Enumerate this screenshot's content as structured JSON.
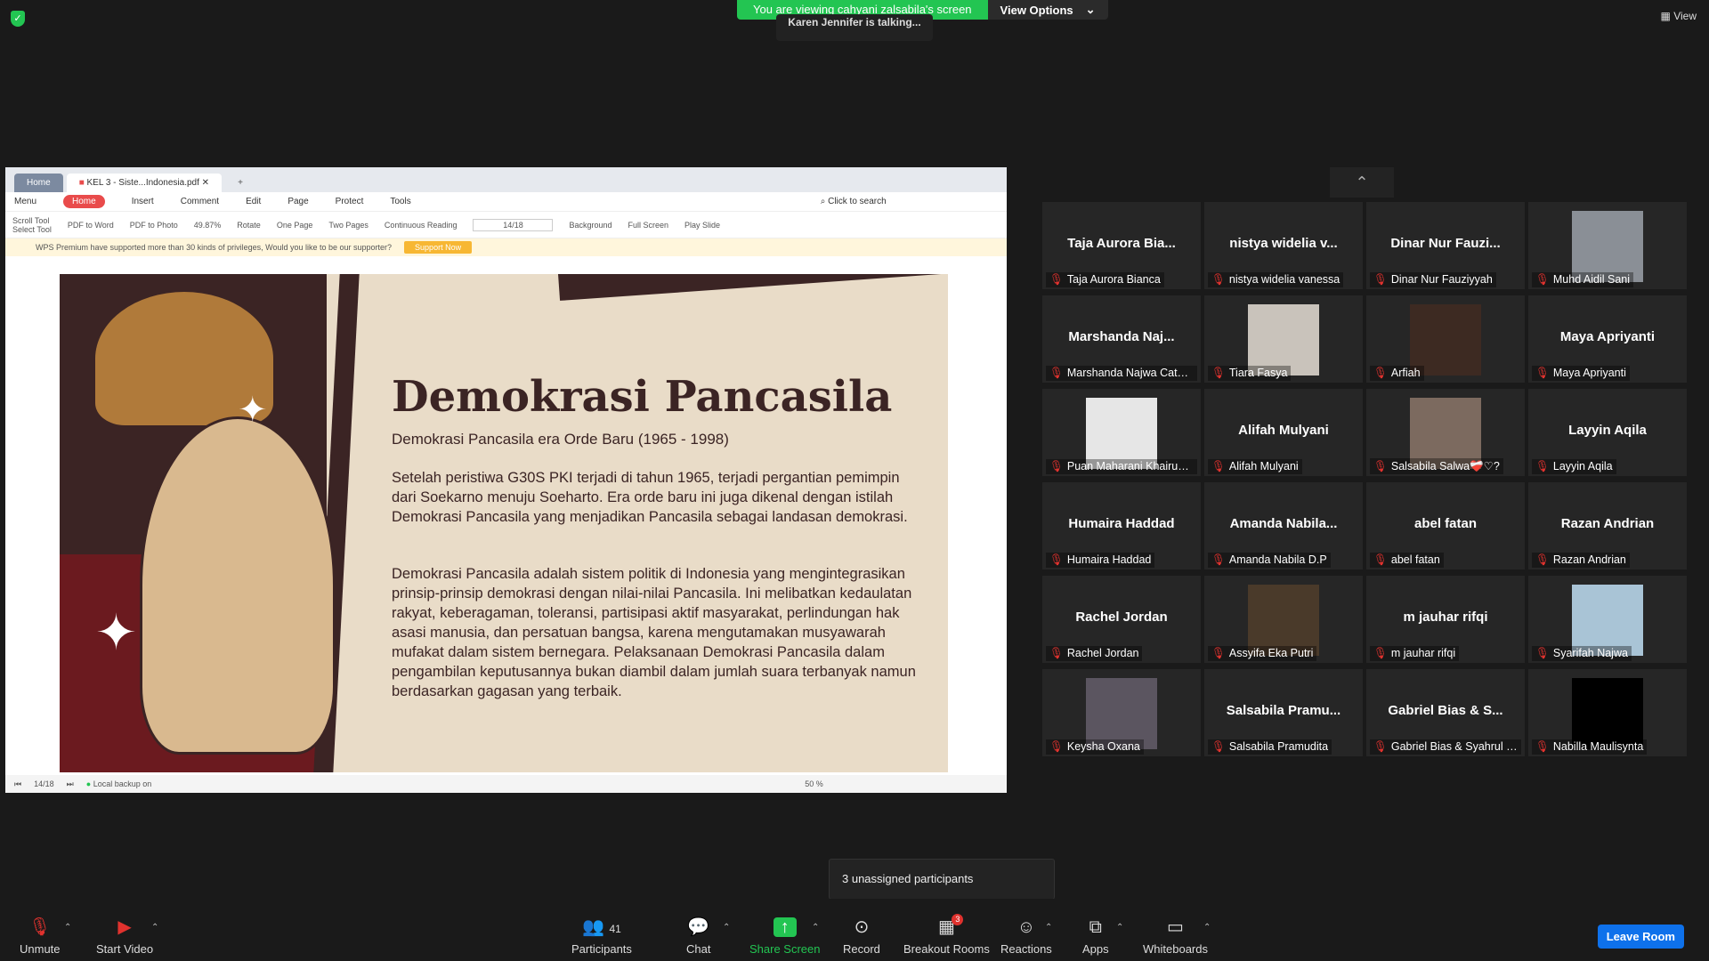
{
  "banner": {
    "viewing": "You are viewing cahyani zalsabila's screen",
    "view_options": "View Options"
  },
  "talking": "Karen Jennifer is talking...",
  "view_button": "View",
  "wps": {
    "tabs": [
      "Home",
      "KEL 3 - Siste...Indonesia.pdf"
    ],
    "menu": [
      "Menu",
      "Home",
      "Insert",
      "Comment",
      "Edit",
      "Page",
      "Protect",
      "Tools"
    ],
    "search": "Click to search",
    "toolbar": [
      "Scroll Tool",
      "Select Tool",
      "PDF to Word",
      "PDF to Photo",
      "49.87%",
      "Rotate",
      "One Page",
      "Two Pages",
      "Continuous Reading",
      "Background",
      "Full Screen",
      "Play Slide"
    ],
    "page_field": "14/18",
    "notice": "WPS Premium have supported more than 30 kinds of privileges, Would you like to be our supporter?",
    "support_button": "Support Now",
    "status_backup": "Local backup on",
    "zoom": "50 %"
  },
  "slide": {
    "title": "Demokrasi Pancasila",
    "subtitle": "Demokrasi Pancasila era Orde Baru (1965 - 1998)",
    "para1": "Setelah peristiwa G30S PKI terjadi di tahun 1965, terjadi pergantian pemimpin dari Soekarno menuju Soeharto. Era orde baru ini juga dikenal dengan istilah Demokrasi Pancasila yang menjadikan Pancasila sebagai landasan demokrasi.",
    "para2": "Demokrasi Pancasila adalah sistem politik di Indonesia yang mengintegrasikan prinsip-prinsip demokrasi dengan nilai-nilai Pancasila. Ini melibatkan kedaulatan rakyat, keberagaman, toleransi, partisipasi aktif masyarakat, perlindungan hak asasi manusia, dan persatuan bangsa, karena mengutamakan musyawarah mufakat dalam sistem bernegara. Pelaksanaan Demokrasi Pancasila dalam pengambilan keputusannya bukan diambil dalam jumlah suara terbanyak namun berdasarkan gagasan yang terbaik."
  },
  "participants": [
    {
      "big": "Taja Aurora Bia...",
      "name": "Taja Aurora Bianca",
      "photo": false
    },
    {
      "big": "nistya widelia v...",
      "name": "nistya widelia vanessa",
      "photo": false
    },
    {
      "big": "Dinar Nur Fauzi...",
      "name": "Dinar Nur Fauziyyah",
      "photo": false
    },
    {
      "big": "",
      "name": "Muhd Aidil Sani",
      "photo": true,
      "color": "#8a8f96"
    },
    {
      "big": "Marshanda Naj...",
      "name": "Marshanda Najwa Catel...",
      "photo": false
    },
    {
      "big": "",
      "name": "Tiara Fasya",
      "photo": true,
      "color": "#c9c3bb"
    },
    {
      "big": "",
      "name": "Arfiah",
      "photo": true,
      "color": "#3d2a22"
    },
    {
      "big": "Maya Apriyanti",
      "name": "Maya Apriyanti",
      "photo": false
    },
    {
      "big": "",
      "name": "Puan Maharani Khairunn...",
      "photo": true,
      "color": "#e6e6e6"
    },
    {
      "big": "Alifah Mulyani",
      "name": "Alifah Mulyani",
      "photo": false
    },
    {
      "big": "",
      "name": "Salsabila Salwa❤️‍🩹♡?",
      "photo": true,
      "color": "#7c6a5f"
    },
    {
      "big": "Layyin Aqila",
      "name": "Layyin Aqila",
      "photo": false
    },
    {
      "big": "Humaira Haddad",
      "name": "Humaira Haddad",
      "photo": false
    },
    {
      "big": "Amanda Nabila...",
      "name": "Amanda Nabila D.P",
      "photo": false
    },
    {
      "big": "abel fatan",
      "name": "abel fatan",
      "photo": false
    },
    {
      "big": "Razan Andrian",
      "name": "Razan Andrian",
      "photo": false
    },
    {
      "big": "Rachel Jordan",
      "name": "Rachel Jordan",
      "photo": false
    },
    {
      "big": "",
      "name": "Assyifa Eka Putri",
      "photo": true,
      "color": "#4a3a2a"
    },
    {
      "big": "m jauhar rifqi",
      "name": "m jauhar rifqi",
      "photo": false
    },
    {
      "big": "",
      "name": "Syarifah Najwa",
      "photo": true,
      "color": "#a9c4d6"
    },
    {
      "big": "",
      "name": "Keysha Oxana",
      "photo": true,
      "color": "#5b5560"
    },
    {
      "big": "Salsabila Pramu...",
      "name": "Salsabila Pramudita",
      "photo": false
    },
    {
      "big": "Gabriel Bias & S...",
      "name": "Gabriel Bias & Syahrul G...",
      "photo": false
    },
    {
      "big": "",
      "name": "Nabilla Maulisynta",
      "photo": true,
      "color": "#000000"
    }
  ],
  "toast": "3 unassigned participants",
  "controls": {
    "unmute": "Unmute",
    "start_video": "Start Video",
    "participants": "Participants",
    "participants_count": "41",
    "chat": "Chat",
    "share_screen": "Share Screen",
    "record": "Record",
    "breakout": "Breakout Rooms",
    "breakout_badge": "3",
    "reactions": "Reactions",
    "apps": "Apps",
    "whiteboards": "Whiteboards",
    "leave": "Leave Room"
  }
}
